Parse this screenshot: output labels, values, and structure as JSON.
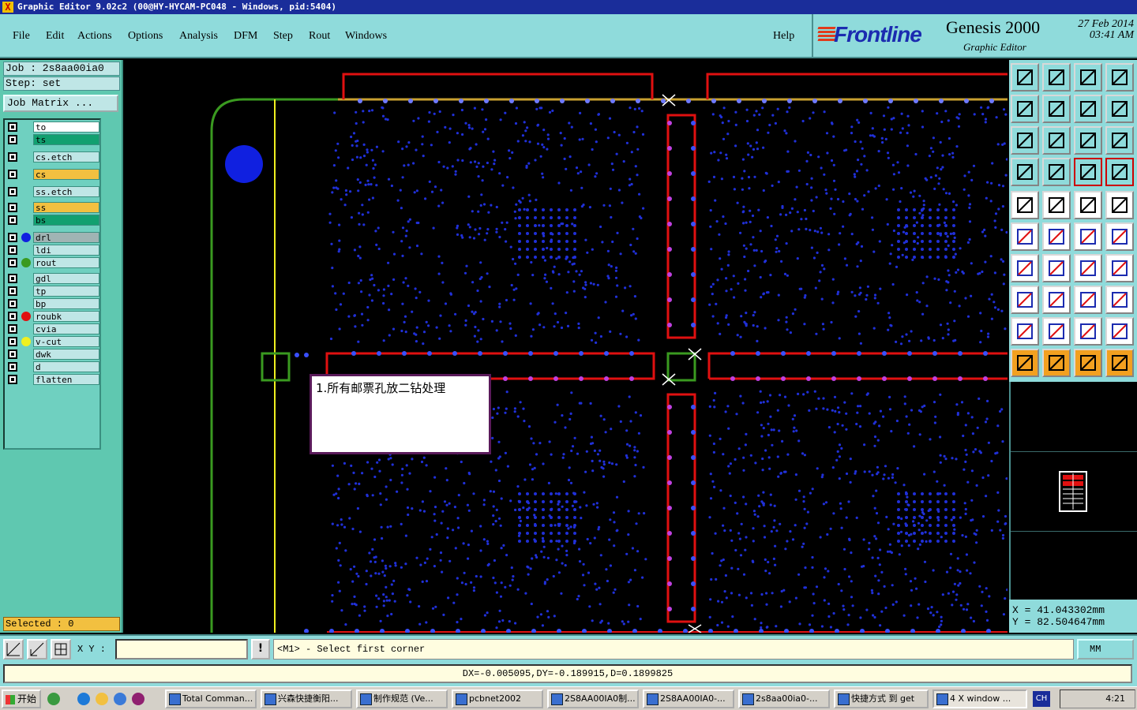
{
  "title": "Graphic Editor 9.02c2 (00@HY-HYCAM-PC048 - Windows, pid:5404)",
  "menu": [
    "File",
    "Edit",
    "Actions",
    "Options",
    "Analysis",
    "DFM",
    "Step",
    "Rout",
    "Windows"
  ],
  "help": "Help",
  "brand": {
    "logo": "Frontline",
    "product": "Genesis 2000",
    "subtitle": "Graphic Editor",
    "date": "27 Feb 2014",
    "time": "03:41 AM"
  },
  "job": "Job : 2s8aa00ia0",
  "step": "Step: set",
  "job_matrix": "Job Matrix ...",
  "layers": [
    {
      "name": "to",
      "color": "#ffffff"
    },
    {
      "name": "ts",
      "color": "#12a070"
    },
    {
      "name": "cs.etch",
      "color": "#bfe6e6"
    },
    {
      "name": "cs",
      "color": "#f2c040"
    },
    {
      "name": "ss.etch",
      "color": "#bfe6e6"
    },
    {
      "name": "ss",
      "color": "#f2c040"
    },
    {
      "name": "bs",
      "color": "#12a070"
    },
    {
      "name": "drl",
      "color": "#a0b4b4",
      "dot": "#1020e0"
    },
    {
      "name": "ldi",
      "color": "#bfe6e6"
    },
    {
      "name": "rout",
      "color": "#bfe6e6",
      "dot": "#3a9a20"
    },
    {
      "name": "gdl",
      "color": "#bfe6e6"
    },
    {
      "name": "tp",
      "color": "#bfe6e6"
    },
    {
      "name": "bp",
      "color": "#bfe6e6"
    },
    {
      "name": "roubk",
      "color": "#bfe6e6",
      "dot": "#e01010"
    },
    {
      "name": "cvia",
      "color": "#bfe6e6"
    },
    {
      "name": "v-cut",
      "color": "#bfe6e6",
      "dot": "#f0f020"
    },
    {
      "name": "dwk",
      "color": "#bfe6e6"
    },
    {
      "name": "d",
      "color": "#bfe6e6"
    },
    {
      "name": "flatten",
      "color": "#bfe6e6"
    }
  ],
  "selected": "Selected : 0",
  "note": "1.所有邮票孔放二钻处理",
  "coords": {
    "x": "X = 41.043302mm",
    "y": "Y = 82.504647mm"
  },
  "xy_label": "X Y :",
  "xy_value": "",
  "prompt": "<M1> - Select first corner",
  "units": "MM",
  "measure": "DX=-0.005095,DY=-0.189915,D=0.1899825",
  "taskbar": {
    "start": "开始",
    "tasks": [
      "Total Comman...",
      "兴森快捷衡阳...",
      "制作规范 (Ve...",
      "pcbnet2002",
      "2S8AA00IA0制...",
      "2S8AA00IA0-...",
      "2s8aa00ia0-...",
      "快捷方式 到 get",
      "4 X window ..."
    ],
    "lang": "CH",
    "clock": "4:21"
  }
}
